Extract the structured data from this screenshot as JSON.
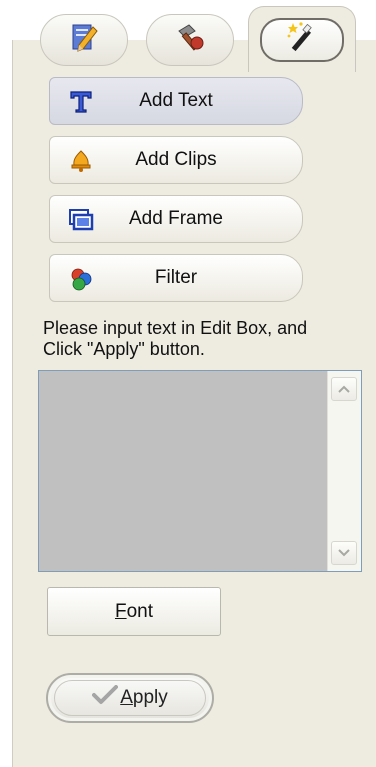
{
  "tabs": [
    {
      "icon": "edit-pencil-icon",
      "active": false
    },
    {
      "icon": "tools-hammer-icon",
      "active": false
    },
    {
      "icon": "effects-wand-icon",
      "active": true
    }
  ],
  "side_buttons": [
    {
      "label": "Add Text",
      "icon": "text-t-icon",
      "active": true
    },
    {
      "label": "Add Clips",
      "icon": "clips-bell-icon",
      "active": false
    },
    {
      "label": "Add Frame",
      "icon": "frame-icon",
      "active": false
    },
    {
      "label": "Filter",
      "icon": "filter-balls-icon",
      "active": false
    }
  ],
  "instructions": "Please input text in Edit Box, and\nClick \"Apply\" button.",
  "edit_box": {
    "value": ""
  },
  "font_button": {
    "mnemonic": "F",
    "rest": "ont"
  },
  "apply_button": {
    "mnemonic": "A",
    "rest": "pply"
  },
  "colors": {
    "panel_bg": "#eeece1",
    "edit_bg": "#c0c0c0",
    "active_btn": "#dcdde6"
  }
}
